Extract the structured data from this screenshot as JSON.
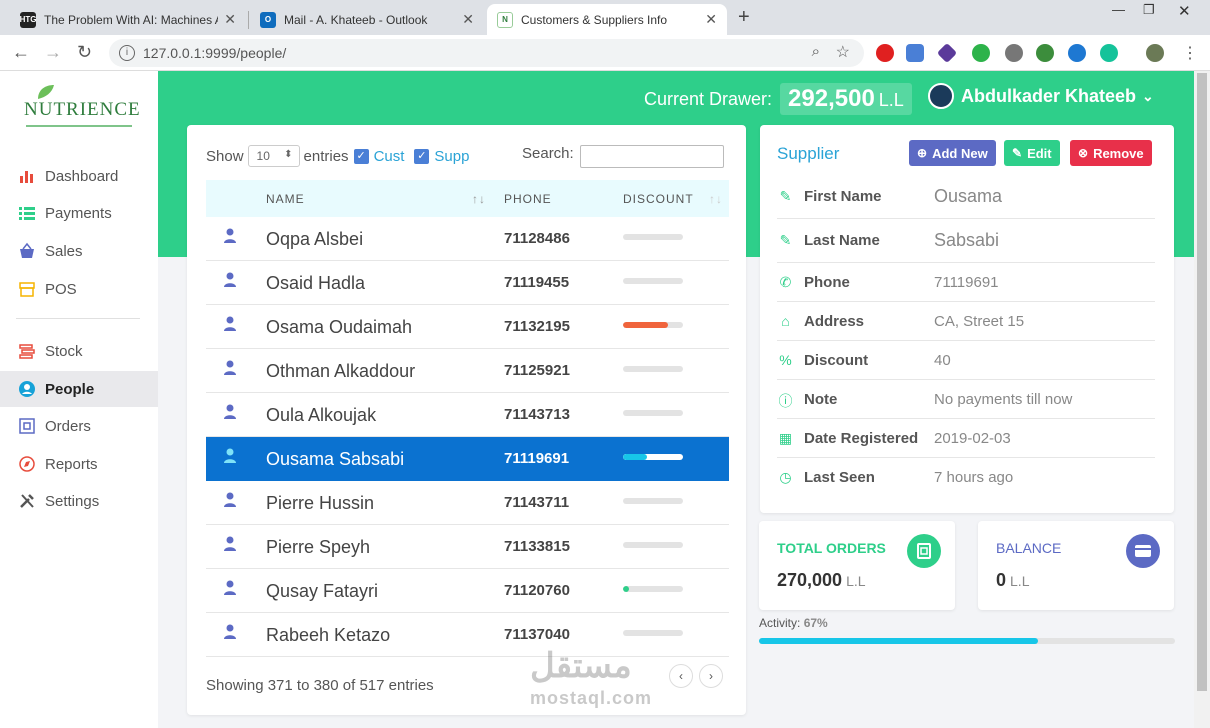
{
  "browser": {
    "tabs": [
      {
        "favicon": "HTG",
        "title": "The Problem With AI: Machines A"
      },
      {
        "favicon": "O",
        "title": "Mail - A. Khateeb - Outlook"
      },
      {
        "favicon": "N",
        "title": "Customers & Suppliers Info"
      }
    ],
    "url": "127.0.0.1:9999/people/"
  },
  "sidebar": {
    "logo": "NUTRIENCE",
    "items": [
      {
        "label": "Dashboard",
        "icon": "bar-chart-icon",
        "color": "#e74c3c"
      },
      {
        "label": "Payments",
        "icon": "list-icon",
        "color": "#2ecf8a"
      },
      {
        "label": "Sales",
        "icon": "basket-icon",
        "color": "#5c6ac4"
      },
      {
        "label": "POS",
        "icon": "store-icon",
        "color": "#f5b400"
      },
      {
        "label": "Stock",
        "icon": "stack-icon",
        "color": "#e74c3c"
      },
      {
        "label": "People",
        "icon": "person-circle-icon",
        "color": "#17a2d8"
      },
      {
        "label": "Orders",
        "icon": "orders-icon",
        "color": "#5c6ac4"
      },
      {
        "label": "Reports",
        "icon": "compass-icon",
        "color": "#e74c3c"
      },
      {
        "label": "Settings",
        "icon": "tools-icon",
        "color": "#555"
      }
    ]
  },
  "header": {
    "drawer_label": "Current Drawer:",
    "drawer_amount": "292,500",
    "drawer_currency": "L.L",
    "user_name": "Abdulkader Khateeb"
  },
  "table": {
    "show_label": "Show",
    "page_size": "10",
    "entries_label": "entries",
    "cust_label": "Cust",
    "supp_label": "Supp",
    "search_label": "Search:",
    "columns": [
      "NAME",
      "PHONE",
      "DISCOUNT"
    ],
    "rows": [
      {
        "name": "Oqpa Alsbei",
        "phone": "71128486",
        "discount": 0,
        "color": "#e3e3e3"
      },
      {
        "name": "Osaid Hadla",
        "phone": "71119455",
        "discount": 0,
        "color": "#e3e3e3"
      },
      {
        "name": "Osama Oudaimah",
        "phone": "71132195",
        "discount": 75,
        "color": "#f0643c"
      },
      {
        "name": "Othman Alkaddour",
        "phone": "71125921",
        "discount": 0,
        "color": "#e3e3e3"
      },
      {
        "name": "Oula Alkoujak",
        "phone": "71143713",
        "discount": 0,
        "color": "#e3e3e3"
      },
      {
        "name": "Ousama Sabsabi",
        "phone": "71119691",
        "discount": 40,
        "color": "#17c6e8",
        "selected": true
      },
      {
        "name": "Pierre Hussin",
        "phone": "71143711",
        "discount": 0,
        "color": "#e3e3e3"
      },
      {
        "name": "Pierre Speyh",
        "phone": "71133815",
        "discount": 0,
        "color": "#e3e3e3"
      },
      {
        "name": "Qusay Fatayri",
        "phone": "71120760",
        "discount": 10,
        "color": "#2ecf8a"
      },
      {
        "name": "Rabeeh Ketazo",
        "phone": "71137040",
        "discount": 0,
        "color": "#e3e3e3"
      }
    ],
    "info": "Showing 371 to 380 of 517 entries"
  },
  "supplier": {
    "title": "Supplier",
    "add_label": "Add New",
    "edit_label": "Edit",
    "remove_label": "Remove",
    "fields": [
      {
        "label": "First Name",
        "value": "Ousama",
        "icon": "edit-icon"
      },
      {
        "label": "Last Name",
        "value": "Sabsabi",
        "icon": "edit-icon"
      },
      {
        "label": "Phone",
        "value": "71119691",
        "icon": "phone-icon"
      },
      {
        "label": "Address",
        "value": "CA, Street 15",
        "icon": "home-icon"
      },
      {
        "label": "Discount",
        "value": "40",
        "icon": "percent-icon"
      },
      {
        "label": "Note",
        "value": "No payments till now",
        "icon": "info-icon"
      },
      {
        "label": "Date Registered",
        "value": "2019-02-03",
        "icon": "calendar-icon"
      },
      {
        "label": "Last Seen",
        "value": "7 hours ago",
        "icon": "clock-icon"
      }
    ]
  },
  "stats": {
    "orders_label": "TOTAL ORDERS",
    "orders_value": "270,000",
    "orders_unit": "L.L",
    "balance_label": "BALANCE",
    "balance_value": "0",
    "balance_unit": "L.L",
    "activity_label": "Activity:",
    "activity_value": "67%",
    "activity_percent": 67
  },
  "watermark": {
    "line1": "مستقل",
    "line2": "mostaql.com"
  }
}
